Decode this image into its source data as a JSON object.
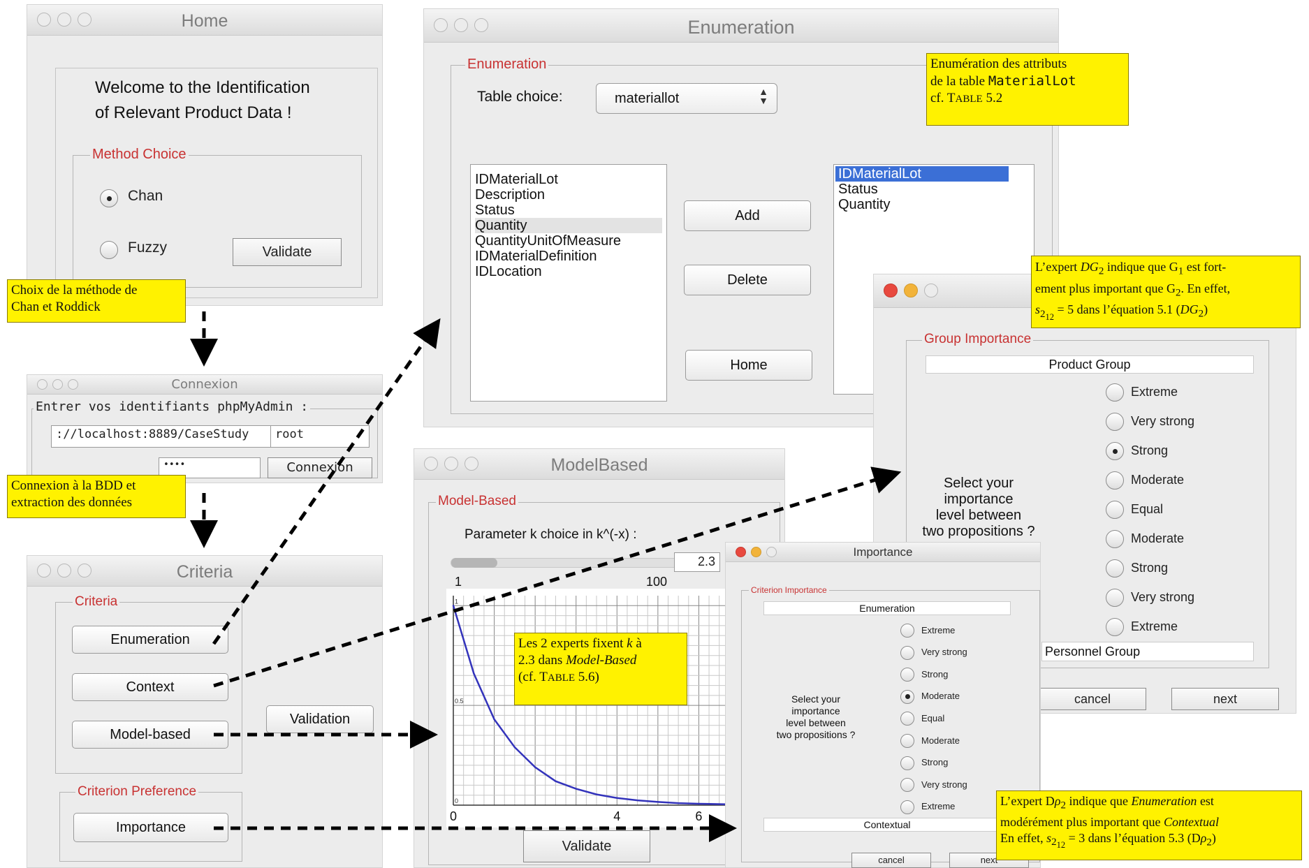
{
  "home": {
    "title": "Home",
    "welcome_line1": "Welcome to the Identification",
    "welcome_line2": "of Relevant Product Data !",
    "method_group": "Method Choice",
    "options": [
      "Chan",
      "Fuzzy"
    ],
    "selected": "Chan",
    "validate": "Validate"
  },
  "connexion": {
    "title": "Connexion",
    "group": "Entrer vos identifiants phpMyAdmin :",
    "url_value": "://localhost:8889/CaseStudy",
    "user_value": "root",
    "password_value": "••••",
    "button": "Connexion"
  },
  "criteria": {
    "title": "Criteria",
    "group": "Criteria",
    "buttons": [
      "Enumeration",
      "Context",
      "Model-based"
    ],
    "validation": "Validation",
    "pref_group": "Criterion Preference",
    "importance": "Importance"
  },
  "enumeration": {
    "title": "Enumeration",
    "group": "Enumeration",
    "table_label": "Table choice:",
    "table_value": "materiallot",
    "left_items": [
      "IDMaterialLot",
      "Description",
      "Status",
      "Quantity",
      "QuantityUnitOfMeasure",
      "IDMaterialDefinition",
      "IDLocation"
    ],
    "right_items": [
      "IDMaterialLot",
      "Status",
      "Quantity"
    ],
    "add": "Add",
    "delete": "Delete",
    "home": "Home"
  },
  "group_importance": {
    "group": "Group Importance",
    "top_bar": "Product Group",
    "bottom_bar": "Personnel Group",
    "prompt": [
      "Select your",
      "importance",
      "level between",
      "two propositions ?"
    ],
    "options": [
      "Extreme",
      "Very strong",
      "Strong",
      "Moderate",
      "Equal",
      "Moderate",
      "Strong",
      "Very strong",
      "Extreme"
    ],
    "selected_index": 2,
    "cancel": "cancel",
    "next": "next"
  },
  "modelbased": {
    "title": "ModelBased",
    "group": "Model-Based",
    "param_label": "Parameter k choice in k^(-x) :",
    "param_value": "2.3",
    "slider_min": "1",
    "slider_max": "100",
    "validate": "Validate"
  },
  "importance": {
    "title": "Importance",
    "group": "Criterion Importance",
    "top_bar": "Enumeration",
    "bottom_bar": "Contextual",
    "prompt": [
      "Select your",
      "importance",
      "level between",
      "two propositions ?"
    ],
    "options": [
      "Extreme",
      "Very strong",
      "Strong",
      "Moderate",
      "Equal",
      "Moderate",
      "Strong",
      "Very strong",
      "Extreme"
    ],
    "selected_index": 3,
    "cancel": "cancel",
    "next": "next"
  },
  "chart_data": {
    "type": "line",
    "x_ticks": [
      "0",
      "4",
      "6"
    ],
    "y_tick_labels": [
      "1",
      "0.5",
      "0"
    ],
    "series": [
      {
        "x": [
          0,
          0.5,
          1,
          1.5,
          2,
          2.5,
          3,
          3.5,
          4,
          4.5,
          5,
          5.5,
          6,
          7
        ],
        "y": [
          1,
          0.66,
          0.43,
          0.29,
          0.19,
          0.12,
          0.082,
          0.054,
          0.036,
          0.024,
          0.016,
          0.01,
          0.007,
          0.003
        ]
      }
    ],
    "xlim": [
      0,
      7
    ],
    "ylim": [
      0,
      1.05
    ],
    "grid": true,
    "line_color": "#3333bb"
  },
  "notes": {
    "n_home": [
      "Choix de la méthode de",
      "Chan et Roddick"
    ],
    "n_conn": [
      "Connexion à la BDD et",
      "extraction des données"
    ],
    "n_enum_1": "Enumération des attributs",
    "n_enum_2a": "de la table ",
    "n_enum_2b": "MaterialLot",
    "n_enum_3a": "cf. T",
    "n_enum_3b": "ABLE",
    "n_enum_3c": " 5.2",
    "n_dg_1a": "L’expert ",
    "n_dg_1b": "DG",
    "n_dg_1c": "2",
    "n_dg_1d": " indique que G",
    "n_dg_1e": "1",
    "n_dg_1f": " est fort-",
    "n_dg_2a": "ement plus important que G",
    "n_dg_2b": "2",
    "n_dg_2c": ". En effet,",
    "n_dg_3a": "s",
    "n_dg_3b": "2",
    "n_dg_3c": "12",
    "n_dg_3d": " = 5 dans l’équation 5.1 (",
    "n_dg_3e": "DG",
    "n_dg_3f": "2",
    "n_dg_3g": ")",
    "n_mb_1a": "Les 2 experts fixent ",
    "n_mb_1b": "k",
    "n_mb_1c": " à",
    "n_mb_2a": "2.3 dans ",
    "n_mb_2b": "Model-Based",
    "n_mb_3a": "(cf. T",
    "n_mb_3b": "ABLE",
    "n_mb_3c": " 5.6)",
    "n_dp_1a": "L’expert D",
    "n_dp_1b": "ρ",
    "n_dp_1c": "2",
    "n_dp_1d": " indique que ",
    "n_dp_1e": "Enumeration",
    "n_dp_1f": " est",
    "n_dp_2a": "modérément plus important que ",
    "n_dp_2b": "Contextual",
    "n_dp_3a": "En effet, ",
    "n_dp_3b": "s",
    "n_dp_3c": "2",
    "n_dp_3d": "12",
    "n_dp_3e": " = 3 dans l’équation 5.3 (D",
    "n_dp_3f": "ρ",
    "n_dp_3g": "2",
    "n_dp_3h": ")"
  }
}
